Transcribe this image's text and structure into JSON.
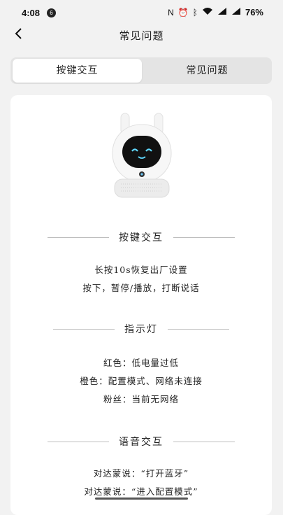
{
  "status": {
    "time": "4:08",
    "badge": "6",
    "battery": "76%"
  },
  "header": {
    "title": "常见问题"
  },
  "tabs": [
    {
      "label": "按键交互",
      "active": true
    },
    {
      "label": "常见问题",
      "active": false
    }
  ],
  "sections": [
    {
      "title": "按键交互",
      "items": [
        "长按10s恢复出厂设置",
        "按下，暂停/播放，打断说话"
      ]
    },
    {
      "title": "指示灯",
      "items": [
        "红色：低电量过低",
        "橙色：配置模式、网络未连接",
        "粉丝：当前无网络"
      ]
    },
    {
      "title": "语音交互",
      "items": [
        "对达蒙说：“打开蓝牙”",
        "对达蒙说：“进入配置模式”"
      ]
    }
  ],
  "colors": {
    "background": "#f2f2f2",
    "card": "#ffffff",
    "robot_face": "#111111",
    "robot_eyes": "#5fd7ff"
  }
}
